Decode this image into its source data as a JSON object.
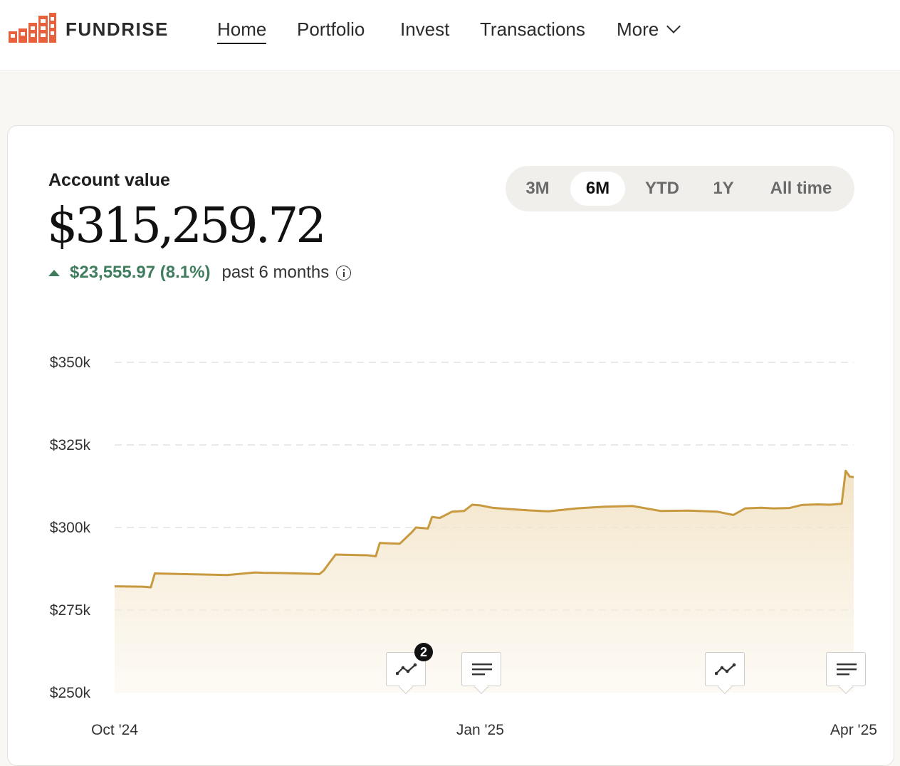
{
  "brand": {
    "name": "FUNDRISE",
    "accent": "#e8603c"
  },
  "nav": {
    "items": [
      {
        "label": "Home",
        "active": true
      },
      {
        "label": "Portfolio",
        "active": false
      },
      {
        "label": "Invest",
        "active": false
      },
      {
        "label": "Transactions",
        "active": false
      },
      {
        "label": "More",
        "active": false
      }
    ]
  },
  "account": {
    "label": "Account value",
    "value": "$315,259.72",
    "change_amount": "$23,555.97 (8.1%)",
    "change_period": "past 6 months",
    "change_color": "#3f7d5e"
  },
  "range": {
    "options": [
      "3M",
      "6M",
      "YTD",
      "1Y",
      "All time"
    ],
    "selected": "6M"
  },
  "markers": [
    {
      "type": "chart-icon",
      "badge": "2"
    },
    {
      "type": "note-icon",
      "badge": ""
    },
    {
      "type": "chart-icon",
      "badge": ""
    },
    {
      "type": "note-icon",
      "badge": ""
    }
  ],
  "chart_data": {
    "type": "area",
    "line_color": "#c8993f",
    "grid": true,
    "ylim": [
      250000,
      350000
    ],
    "yticks": [
      "$350k",
      "$325k",
      "$300k",
      "$275k",
      "$250k"
    ],
    "ytick_values": [
      350000,
      325000,
      300000,
      275000,
      250000
    ],
    "xticks": [
      "Oct '24",
      "Jan '25",
      "Apr '25"
    ],
    "xlim": [
      "2024-10-02",
      "2025-04-04"
    ],
    "xtick_dates": [
      "2024-10-02",
      "2025-01-01",
      "2025-04-04"
    ],
    "x": [
      "2024-10-02",
      "2024-10-09",
      "2024-10-11",
      "2024-10-12",
      "2024-10-16",
      "2024-10-23",
      "2024-10-30",
      "2024-11-06",
      "2024-11-08",
      "2024-11-13",
      "2024-11-20",
      "2024-11-22",
      "2024-11-23",
      "2024-11-26",
      "2024-12-04",
      "2024-12-06",
      "2024-12-07",
      "2024-12-12",
      "2024-12-15",
      "2024-12-16",
      "2024-12-19",
      "2024-12-20",
      "2024-12-22",
      "2024-12-25",
      "2024-12-28",
      "2024-12-30",
      "2025-01-01",
      "2025-01-04",
      "2025-01-08",
      "2025-01-13",
      "2025-01-18",
      "2025-01-25",
      "2025-02-01",
      "2025-02-08",
      "2025-02-15",
      "2025-02-22",
      "2025-03-01",
      "2025-03-05",
      "2025-03-08",
      "2025-03-12",
      "2025-03-15",
      "2025-03-19",
      "2025-03-22",
      "2025-03-26",
      "2025-03-29",
      "2025-04-01",
      "2025-04-02",
      "2025-04-03",
      "2025-04-04"
    ],
    "series": [
      {
        "values": [
          282200,
          282100,
          281900,
          286100,
          286000,
          285800,
          285600,
          286400,
          286300,
          286200,
          286000,
          285900,
          286900,
          291800,
          291600,
          291300,
          295300,
          295100,
          298600,
          300000,
          299700,
          303200,
          302900,
          304800,
          305000,
          306900,
          306700,
          306000,
          305600,
          305200,
          304900,
          305800,
          306300,
          306500,
          305000,
          305100,
          304800,
          303800,
          305800,
          306000,
          305800,
          305900,
          306800,
          307000,
          306900,
          307200,
          317200,
          315400,
          315260
        ]
      }
    ]
  }
}
